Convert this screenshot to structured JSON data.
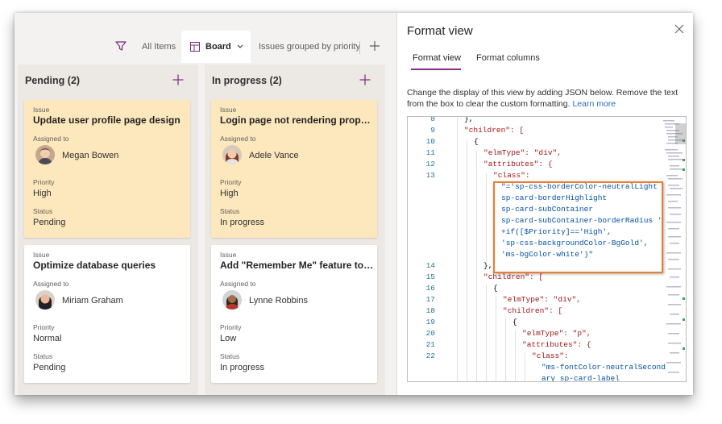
{
  "viewbar": {
    "all_items": "All Items",
    "board": "Board",
    "grouped": "Issues grouped by priority"
  },
  "lanes": [
    {
      "title": "Pending (2)",
      "cards": [
        {
          "issue_label": "Issue",
          "title": "Update user profile page design",
          "assigned_label": "Assigned to",
          "person": "Megan Bowen",
          "priority_label": "Priority",
          "priority": "High",
          "status_label": "Status",
          "status": "Pending"
        },
        {
          "issue_label": "Issue",
          "title": "Optimize database queries",
          "assigned_label": "Assigned to",
          "person": "Miriam Graham",
          "priority_label": "Priority",
          "priority": "Normal",
          "status_label": "Status",
          "status": "Pending"
        }
      ]
    },
    {
      "title": "In progress (2)",
      "cards": [
        {
          "issue_label": "Issue",
          "title": "Login page not rendering properly",
          "assigned_label": "Assigned to",
          "person": "Adele Vance",
          "priority_label": "Priority",
          "priority": "High",
          "status_label": "Status",
          "status": "In progress"
        },
        {
          "issue_label": "Issue",
          "title": "Add \"Remember Me\" feature to lo...",
          "assigned_label": "Assigned to",
          "person": "Lynne Robbins",
          "priority_label": "Priority",
          "priority": "Low",
          "status_label": "Status",
          "status": "In progress"
        }
      ]
    }
  ],
  "panel": {
    "title": "Format view",
    "tab_view": "Format view",
    "tab_columns": "Format columns",
    "description": "Change the display of this view by adding JSON below. Remove the text from the box to clear the custom formatting.",
    "learn_more": "Learn more"
  },
  "editor": {
    "line_numbers": [
      "8",
      "9",
      "10",
      "11",
      "12",
      "13",
      "14",
      "15",
      "16",
      "17",
      "18",
      "19",
      "20",
      "21",
      "22"
    ],
    "lines": [
      "},",
      "\"children\": [",
      "{",
      "\"elmType\": \"div\",",
      "\"attributes\": {",
      "\"class\":",
      "\"='sp-css-borderColor-neutralLight",
      "sp-card-borderHighlight",
      "sp-card-subContainer",
      "sp-card-subContainer-borderRadius '",
      "+if([$Priority]=='High',",
      "'sp-css-backgroundColor-BgGold',",
      "'ms-bgColor-white')\"",
      "},",
      "\"children\": [",
      "{",
      "\"elmType\": \"div\",",
      "\"children\": [",
      "{",
      "\"elmType\": \"p\",",
      "\"attributes\": {",
      "\"class\":",
      "\"ms-fontColor-neutralSecond",
      "ary sp-card-label"
    ]
  },
  "colors": {
    "highlight_card": "#fde7bd",
    "accent_tab": "#8a2f87",
    "callout_border": "#ed7d31",
    "link": "#2b6fb6"
  }
}
